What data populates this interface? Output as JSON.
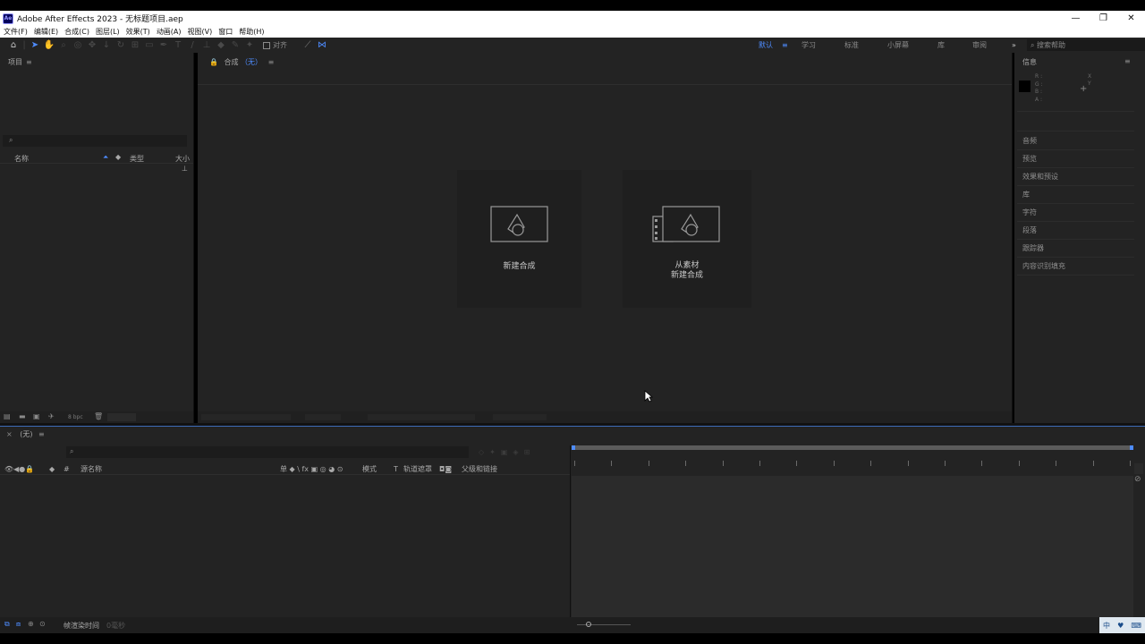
{
  "window": {
    "app_icon_text": "Ae",
    "title": "Adobe After Effects 2023 - 无标题项目.aep",
    "controls": [
      "—",
      "❐",
      "✕"
    ]
  },
  "menu": [
    "文件(F)",
    "编辑(E)",
    "合成(C)",
    "图层(L)",
    "效果(T)",
    "动画(A)",
    "视图(V)",
    "窗口",
    "帮助(H)"
  ],
  "toolbar": {
    "snap_label": "对齐",
    "workspaces": [
      "默认",
      "学习",
      "标准",
      "小屏幕",
      "库",
      "审阅"
    ],
    "active_workspace": "默认",
    "overflow": "»",
    "search_help": "搜索帮助"
  },
  "project_panel": {
    "title": "项目",
    "search_icon": "⌕",
    "col_name": "名称",
    "col_type": "类型",
    "col_size": "大小",
    "footer_bpc": "8 bpc"
  },
  "composition_panel": {
    "title": "合成",
    "comp_name": "（无）",
    "new_comp_label": "新建合成",
    "from_footage_line1": "从素材",
    "from_footage_line2": "新建合成"
  },
  "info_panel": {
    "title": "信息",
    "rgba": [
      "R :",
      "G :",
      "B :",
      "A :"
    ],
    "xy": [
      "X",
      "Y"
    ],
    "crosshair": "+",
    "panels": [
      "音频",
      "预览",
      "效果和预设",
      "库",
      "字符",
      "段落",
      "跟踪器",
      "内容识别填充"
    ]
  },
  "timeline": {
    "tab_close": "×",
    "tab_name": "(无)",
    "search_icon": "⌕",
    "col_source_name": "源名称",
    "col_switches": "单 ◆ \\ fx ▣ ◎ ◕ ⊙",
    "col_mode": "模式",
    "col_t": "T",
    "col_track_matte": "轨道遮罩",
    "col_parent": "父级和链接",
    "col_hash": "#",
    "footer_render_time": "帧渲染时间",
    "footer_render_value": "0毫秒"
  },
  "taskbar_tray": [
    "中",
    "♥",
    "⌨"
  ],
  "colors": {
    "accent": "#4e8cff",
    "panel": "#232323",
    "panel_dark": "#1d1d1d",
    "timeline_graph": "#2b2b2b"
  }
}
